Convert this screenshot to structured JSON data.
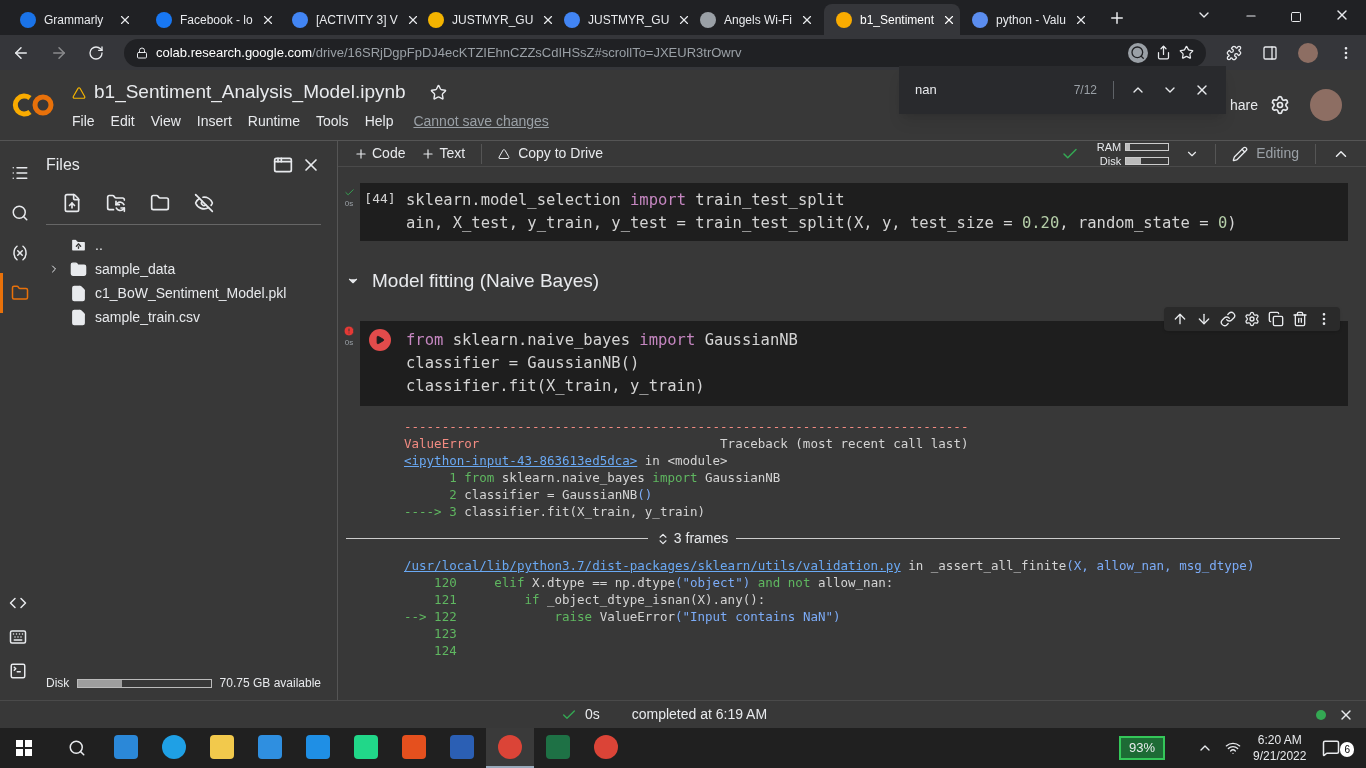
{
  "browser": {
    "tabs": [
      {
        "title": "Grammarly",
        "color": "#1a73e8",
        "selected": false
      },
      {
        "title": "Facebook - lo",
        "color": "#1877f2",
        "selected": false
      },
      {
        "title": "[ACTIVITY 3] V",
        "color": "#4285f4",
        "selected": false
      },
      {
        "title": "JUSTMYR_GU",
        "color": "#f4b400",
        "selected": false
      },
      {
        "title": "JUSTMYR_GU",
        "color": "#4285f4",
        "selected": false
      },
      {
        "title": "Angels Wi-Fi",
        "color": "#9aa0a6",
        "selected": false
      },
      {
        "title": "b1_Sentiment",
        "color": "#f9ab00",
        "selected": true
      },
      {
        "title": "python - Valu",
        "color": "#5b8def",
        "selected": false
      }
    ],
    "address": {
      "host": "colab.research.google.com",
      "path": "/drive/16SRjDgpFpDJ4ecKTZIEhnCZZsCdIHSsZ#scrollTo=JXEUR3trOwrv"
    }
  },
  "notebook": {
    "title": "b1_Sentiment_Analysis_Model.ipynb",
    "menu": [
      "File",
      "Edit",
      "View",
      "Insert",
      "Runtime",
      "Tools",
      "Help"
    ],
    "save_notice": "Cannot save changes",
    "share": "hare"
  },
  "find_bar": {
    "query": "nan",
    "count": "7/12"
  },
  "toolbar": {
    "add": [
      "Code",
      "Text"
    ],
    "copy": "Copy to Drive",
    "ram": {
      "label": "RAM",
      "level": 0.1
    },
    "disk": {
      "label": "Disk",
      "level": 0.35
    },
    "mode": "Editing"
  },
  "rail": {
    "top": [
      {
        "kind": "contents",
        "selected": false
      },
      {
        "kind": "search",
        "selected": false
      },
      {
        "kind": "variables",
        "selected": false
      },
      {
        "kind": "files",
        "selected": true
      }
    ],
    "bottom": [
      {
        "kind": "snippets"
      },
      {
        "kind": "palette"
      },
      {
        "kind": "terminal"
      }
    ]
  },
  "files": {
    "title": "Files",
    "items": [
      {
        "name": "..",
        "kind": "parent"
      },
      {
        "name": "sample_data",
        "kind": "folder",
        "expanded": false
      },
      {
        "name": "c1_BoW_Sentiment_Model.pkl",
        "kind": "file"
      },
      {
        "name": "sample_train.csv",
        "kind": "file"
      }
    ],
    "disk": {
      "label": "Disk",
      "level": 0.33,
      "text": "70.75 GB available"
    }
  },
  "cells": [
    {
      "kind": "code",
      "failed": false,
      "time": "0s",
      "count": "[44]",
      "lines": [
        [
          {
            "kind": "plain",
            "text": "sklearn.model_selection "
          },
          {
            "kind": "keyword",
            "text": "import"
          },
          {
            "kind": "plain",
            "text": " train_test_split"
          }
        ],
        [
          {
            "kind": "plain",
            "text": "ain, X_test, y_train, y_test = train_test_split(X, y, test_size = "
          },
          {
            "kind": "number",
            "text": "0.20"
          },
          {
            "kind": "plain",
            "text": ", random_state = "
          },
          {
            "kind": "number",
            "text": "0"
          },
          {
            "kind": "plain",
            "text": ")"
          }
        ]
      ]
    },
    {
      "kind": "heading",
      "text": "Model fitting (Naive Bayes)",
      "expanded": true
    },
    {
      "kind": "code",
      "failed": true,
      "time": "0s",
      "lines": [
        [
          {
            "kind": "keyword",
            "text": "from"
          },
          {
            "kind": "plain",
            "text": " sklearn.naive_bayes "
          },
          {
            "kind": "keyword",
            "text": "import"
          },
          {
            "kind": "plain",
            "text": " GaussianNB"
          }
        ],
        [
          {
            "kind": "plain",
            "text": "classifier = GaussianNB()"
          }
        ],
        [
          {
            "kind": "plain",
            "text": "classifier.fit(X_train, y_train)"
          }
        ]
      ],
      "output": {
        "before": [
          [
            {
              "kind": "error",
              "text": "---------------------------------------------------------------------------"
            }
          ],
          [
            {
              "kind": "error",
              "text": "ValueError"
            },
            {
              "kind": "plain",
              "text": "                                Traceback (most recent call last)"
            }
          ],
          [
            {
              "kind": "link",
              "text": "<ipython-input-43-863613ed5dca>"
            },
            {
              "kind": "plain",
              "text": " in <module>"
            }
          ],
          [
            {
              "kind": "green",
              "text": "      1 from"
            },
            {
              "kind": "plain",
              "text": " sklearn.naive_bayes "
            },
            {
              "kind": "green",
              "text": "import"
            },
            {
              "kind": "plain",
              "text": " GaussianNB"
            }
          ],
          [
            {
              "kind": "green",
              "text": "      2"
            },
            {
              "kind": "plain",
              "text": " classifier = GaussianNB"
            },
            {
              "kind": "blue",
              "text": "()"
            }
          ],
          [
            {
              "kind": "green",
              "text": "----> 3"
            },
            {
              "kind": "plain",
              "text": " classifier.fit(X_train, y_train)"
            }
          ]
        ],
        "frames": "3 frames",
        "after": [
          [
            {
              "kind": "link",
              "text": "/usr/local/lib/python3.7/dist-packages/sklearn/utils/validation.py"
            },
            {
              "kind": "plain",
              "text": " in _assert_all_finite"
            },
            {
              "kind": "blue",
              "text": "(X, allow_nan, msg_dtype)"
            }
          ],
          [
            {
              "kind": "green",
              "text": "    120     elif"
            },
            {
              "kind": "plain",
              "text": " X.dtype == np.dtype"
            },
            {
              "kind": "blue",
              "text": "(\"object\")"
            },
            {
              "kind": "green",
              "text": " and not"
            },
            {
              "kind": "plain",
              "text": " allow_nan:"
            }
          ],
          [
            {
              "kind": "green",
              "text": "    121         if"
            },
            {
              "kind": "plain",
              "text": " _object_dtype_isnan(X).any():"
            }
          ],
          [
            {
              "kind": "green",
              "text": "--> 122             raise"
            },
            {
              "kind": "plain",
              "text": " ValueError"
            },
            {
              "kind": "blue",
              "text": "(\"Input contains NaN\")"
            }
          ],
          [
            {
              "kind": "green",
              "text": "    123"
            }
          ],
          [
            {
              "kind": "green",
              "text": "    124"
            }
          ]
        ]
      }
    }
  ],
  "status": {
    "time": "0s",
    "text": "completed at 6:19 AM",
    "connected": true
  },
  "taskbar": {
    "apps": [
      {
        "kind": "store",
        "selected": false
      },
      {
        "kind": "edge",
        "selected": false
      },
      {
        "kind": "explorer",
        "selected": false
      },
      {
        "kind": "vscode",
        "selected": false
      },
      {
        "kind": "mail",
        "selected": false
      },
      {
        "kind": "pycharm",
        "selected": false
      },
      {
        "kind": "office",
        "selected": false
      },
      {
        "kind": "word",
        "selected": false
      },
      {
        "kind": "chrome",
        "selected": true
      },
      {
        "kind": "excel",
        "selected": false
      },
      {
        "kind": "chrome",
        "selected": false
      }
    ],
    "battery": "93%",
    "time": "6:20 AM",
    "date": "9/21/2022",
    "notifications": "6"
  }
}
